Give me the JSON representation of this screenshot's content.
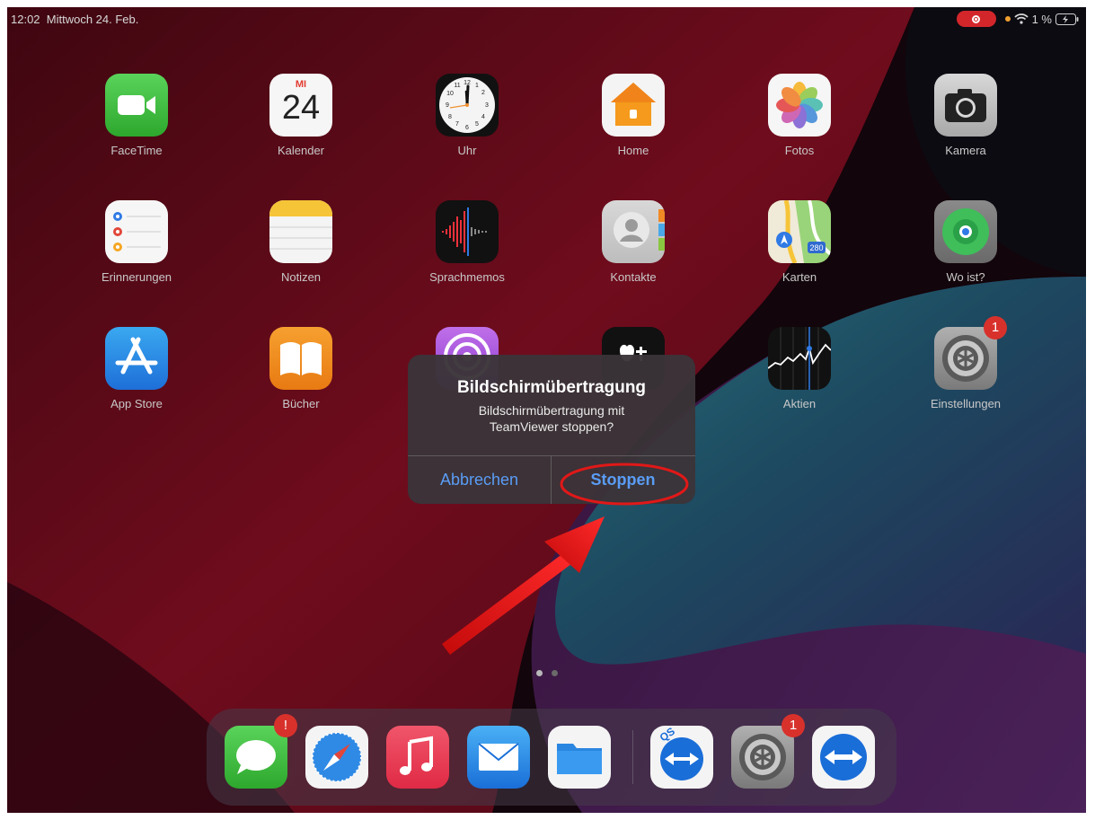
{
  "status_bar": {
    "time": "12:02",
    "date": "Mittwoch 24. Feb.",
    "battery": "1 %"
  },
  "home_apps": [
    {
      "label": "FaceTime",
      "icon": "facetime-icon"
    },
    {
      "label": "Kalender",
      "icon": "calendar-icon",
      "weekday": "MI",
      "day": "24"
    },
    {
      "label": "Uhr",
      "icon": "clock-icon"
    },
    {
      "label": "Home",
      "icon": "home-icon"
    },
    {
      "label": "Fotos",
      "icon": "photos-icon"
    },
    {
      "label": "Kamera",
      "icon": "camera-icon"
    },
    {
      "label": "Erinnerungen",
      "icon": "reminders-icon"
    },
    {
      "label": "Notizen",
      "icon": "notes-icon"
    },
    {
      "label": "Sprachmemos",
      "icon": "voice-memos-icon"
    },
    {
      "label": "Kontakte",
      "icon": "contacts-icon"
    },
    {
      "label": "Karten",
      "icon": "maps-icon",
      "shield": "280"
    },
    {
      "label": "Wo ist?",
      "icon": "find-my-icon"
    },
    {
      "label": "App Store",
      "icon": "app-store-icon"
    },
    {
      "label": "Bücher",
      "icon": "books-icon"
    },
    {
      "label": "",
      "icon": "podcasts-icon"
    },
    {
      "label": "",
      "icon": "apple-tv-icon"
    },
    {
      "label": "Aktien",
      "icon": "stocks-icon"
    },
    {
      "label": "Einstellungen",
      "icon": "settings-icon",
      "badge": "1"
    }
  ],
  "dock": [
    {
      "icon": "messages-icon",
      "badge": "!"
    },
    {
      "icon": "safari-icon"
    },
    {
      "icon": "music-icon"
    },
    {
      "icon": "mail-icon"
    },
    {
      "icon": "files-icon"
    },
    {
      "icon": "teamviewer-qs-icon",
      "text": "QS"
    },
    {
      "icon": "settings-icon",
      "badge": "1"
    },
    {
      "icon": "teamviewer-icon"
    }
  ],
  "alert": {
    "title": "Bildschirmübertragung",
    "message_line1": "Bildschirmübertragung mit",
    "message_line2": "TeamViewer stoppen?",
    "cancel_label": "Abbrechen",
    "stop_label": "Stoppen"
  },
  "colors": {
    "alert_button": "#5a9cf5",
    "annotation": "#e01818",
    "badge": "#d8312c"
  }
}
